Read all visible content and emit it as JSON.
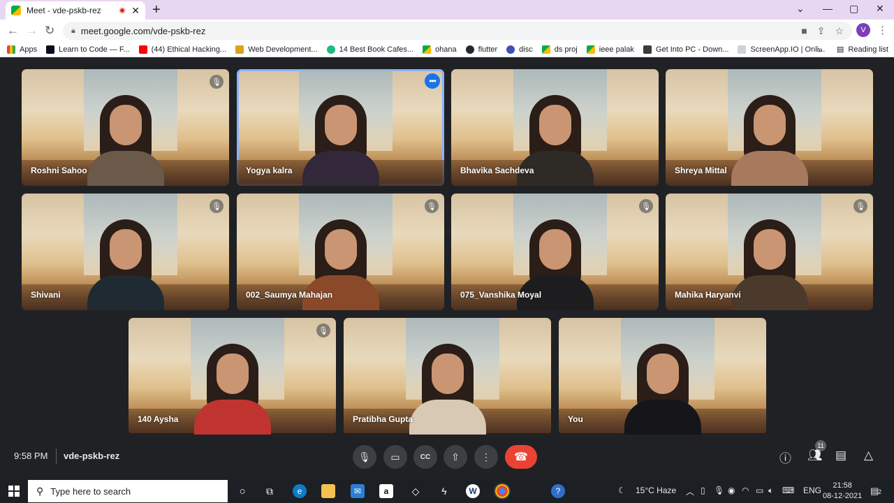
{
  "browser": {
    "tab_title": "Meet - vde-pskb-rez",
    "tab_close": "✕",
    "new_tab": "+",
    "window_controls": [
      "⌄",
      "—",
      "▢",
      "✕"
    ],
    "url": "meet.google.com/vde-pskb-rez",
    "profile_initial": "V",
    "bookmarks": [
      "Apps",
      "Learn to Code — F...",
      "(44) Ethical Hacking...",
      "Web Development...",
      "14 Best Book Cafes...",
      "ohana",
      "flutter",
      "disc",
      "ds proj",
      "ieee palak",
      "Get Into PC - Down...",
      "ScreenApp.IO | Onli..."
    ],
    "bookmarks_more": "»",
    "reading_list": "Reading list"
  },
  "participants": [
    {
      "name": "Roshni Sahoo",
      "muted": true,
      "active": false
    },
    {
      "name": "Yogya kalra",
      "muted": false,
      "active": true
    },
    {
      "name": "Bhavika Sachdeva",
      "muted": false,
      "active": false
    },
    {
      "name": "Shreya Mittal",
      "muted": false,
      "active": false
    },
    {
      "name": "Shivani",
      "muted": true,
      "active": false
    },
    {
      "name": "002_Saumya Mahajan",
      "muted": true,
      "active": false
    },
    {
      "name": "075_Vanshika Moyal",
      "muted": true,
      "active": false
    },
    {
      "name": "Mahika Haryanvi",
      "muted": true,
      "active": false
    },
    {
      "name": "140 Aysha",
      "muted": true,
      "active": false
    },
    {
      "name": "Pratibha Gupta",
      "muted": false,
      "active": false
    },
    {
      "name": "You",
      "muted": false,
      "active": false
    }
  ],
  "meeting": {
    "time": "9:58 PM",
    "code": "vde-pskb-rez",
    "people_count": "11",
    "hangup_color": "#ea4335"
  },
  "taskbar": {
    "search_placeholder": "Type here to search",
    "weather": "15°C  Haze",
    "language": "ENG",
    "clock_time": "21:58",
    "clock_date": "08-12-2021",
    "notifications": "2"
  }
}
